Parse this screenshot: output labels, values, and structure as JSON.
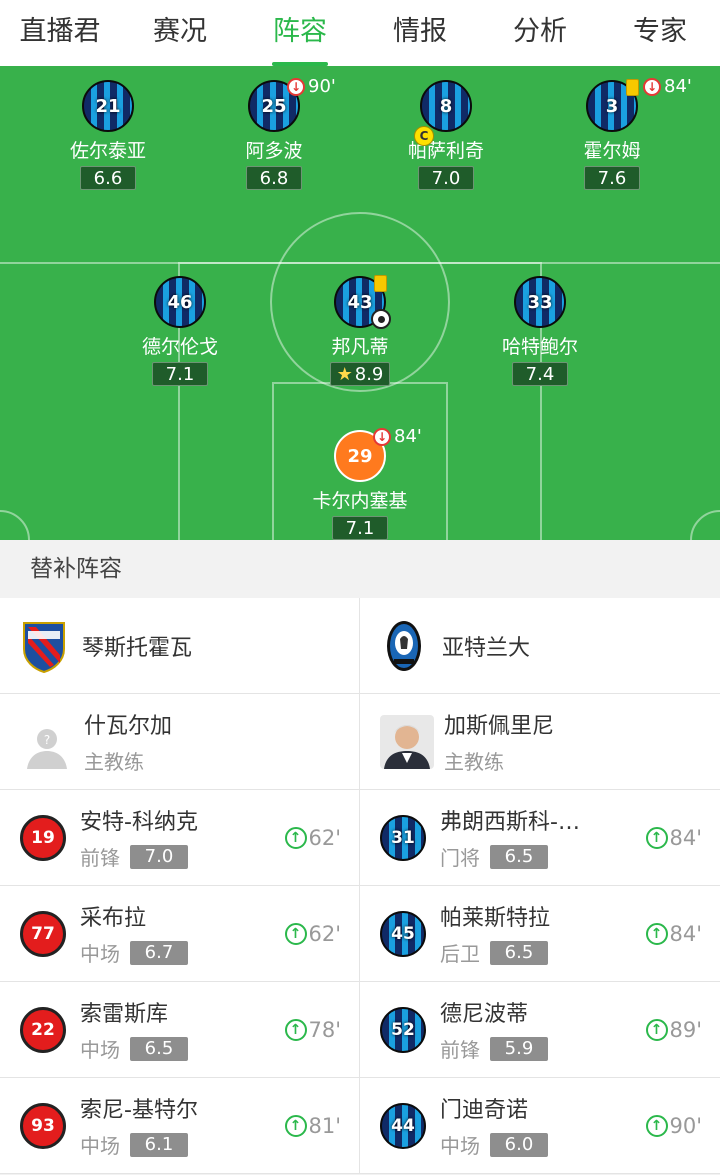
{
  "tabs": [
    "直播君",
    "赛况",
    "阵容",
    "情报",
    "分析",
    "专家"
  ],
  "active_tab": "阵容",
  "lineup": {
    "players": [
      {
        "num": "21",
        "name": "佐尔泰亚",
        "rating": "6.6"
      },
      {
        "num": "25",
        "name": "阿多波",
        "rating": "6.8",
        "sub_off": "90'"
      },
      {
        "num": "8",
        "name": "帕萨利奇",
        "rating": "7.0",
        "captain": "C"
      },
      {
        "num": "3",
        "name": "霍尔姆",
        "rating": "7.6",
        "sub_off": "84'",
        "yellow_card": true
      },
      {
        "num": "46",
        "name": "德尔伦戈",
        "rating": "7.1"
      },
      {
        "num": "43",
        "name": "邦凡蒂",
        "rating": "8.9",
        "yellow_card": true,
        "goal": true,
        "mvp": true
      },
      {
        "num": "33",
        "name": "哈特鲍尔",
        "rating": "7.4"
      },
      {
        "num": "29",
        "name": "卡尔内塞基",
        "rating": "7.1",
        "sub_off": "84'",
        "goalkeeper": true
      }
    ]
  },
  "subs_header": "替补阵容",
  "teams": {
    "home": {
      "name": "琴斯托霍瓦",
      "logo_icon": "rakow-crest-icon",
      "color": "#e31d1d"
    },
    "away": {
      "name": "亚特兰大",
      "logo_icon": "atalanta-crest-icon",
      "color": "#1a66b5"
    }
  },
  "coaches": {
    "home": {
      "name": "什瓦尔加",
      "role": "主教练"
    },
    "away": {
      "name": "加斯佩里尼",
      "role": "主教练"
    }
  },
  "bench": [
    {
      "home": {
        "num": "19",
        "name": "安特-科纳克",
        "pos": "前锋",
        "rating": "7.0",
        "sub_in": "62'"
      },
      "away": {
        "num": "31",
        "name": "弗朗西斯科-…",
        "pos": "门将",
        "rating": "6.5",
        "sub_in": "84'"
      }
    },
    {
      "home": {
        "num": "77",
        "name": "采布拉",
        "pos": "中场",
        "rating": "6.7",
        "sub_in": "62'"
      },
      "away": {
        "num": "45",
        "name": "帕莱斯特拉",
        "pos": "后卫",
        "rating": "6.5",
        "sub_in": "84'"
      }
    },
    {
      "home": {
        "num": "22",
        "name": "索雷斯库",
        "pos": "中场",
        "rating": "6.5",
        "sub_in": "78'"
      },
      "away": {
        "num": "52",
        "name": "德尼波蒂",
        "pos": "前锋",
        "rating": "5.9",
        "sub_in": "89'"
      }
    },
    {
      "home": {
        "num": "93",
        "name": "索尼-基特尔",
        "pos": "中场",
        "rating": "6.1",
        "sub_in": "81'"
      },
      "away": {
        "num": "44",
        "name": "门迪奇诺",
        "pos": "中场",
        "rating": "6.0",
        "sub_in": "90'"
      }
    }
  ]
}
